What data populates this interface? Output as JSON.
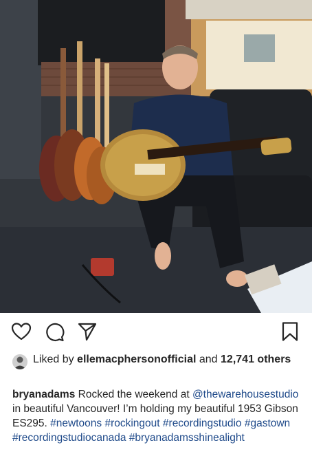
{
  "post": {
    "image_icon": "photo-studio-guitar"
  },
  "actions": {
    "like_icon": "heart-icon",
    "comment_icon": "comment-icon",
    "share_icon": "paper-plane-icon",
    "save_icon": "bookmark-icon"
  },
  "likes": {
    "prefix": "Liked by ",
    "user": "ellemacphersonofficial",
    "joiner": " and ",
    "count": "12,741",
    "suffix": "others"
  },
  "caption": {
    "username": "bryanadams",
    "text_1": " Rocked the weekend at ",
    "mention": "@thewarehousestudio",
    "text_2": " in beautiful Vancouver! I’m holding my beautiful 1953 Gibson ES295. ",
    "hashtags": [
      "#newtoons",
      "#rockingout",
      "#recordingstudio",
      "#gastown",
      "#recordingstudiocanada",
      "#bryanadamsshinealight"
    ]
  },
  "colors": {
    "text": "#262626",
    "link": "#1f4a8a",
    "background": "#ffffff"
  }
}
